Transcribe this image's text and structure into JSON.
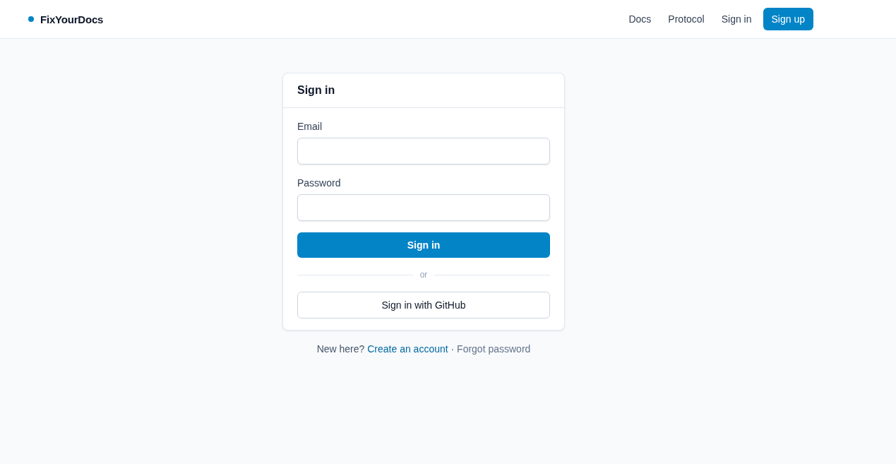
{
  "header": {
    "logo": "FixYourDocs",
    "nav": [
      {
        "label": "Docs",
        "kind": "link"
      },
      {
        "label": "Protocol",
        "kind": "link"
      },
      {
        "label": "Sign in",
        "kind": "link"
      },
      {
        "label": "Sign up",
        "kind": "button"
      }
    ]
  },
  "card": {
    "title": "Sign in",
    "fields": [
      {
        "label": "Email"
      },
      {
        "label": "Password"
      }
    ],
    "submit": "Sign in",
    "divider": "or",
    "oauth_button": "Sign in with GitHub"
  },
  "footer": {
    "prompt": "New here?",
    "create_link": "Create an account",
    "separator": "·",
    "forgot_link": "Forgot password"
  }
}
